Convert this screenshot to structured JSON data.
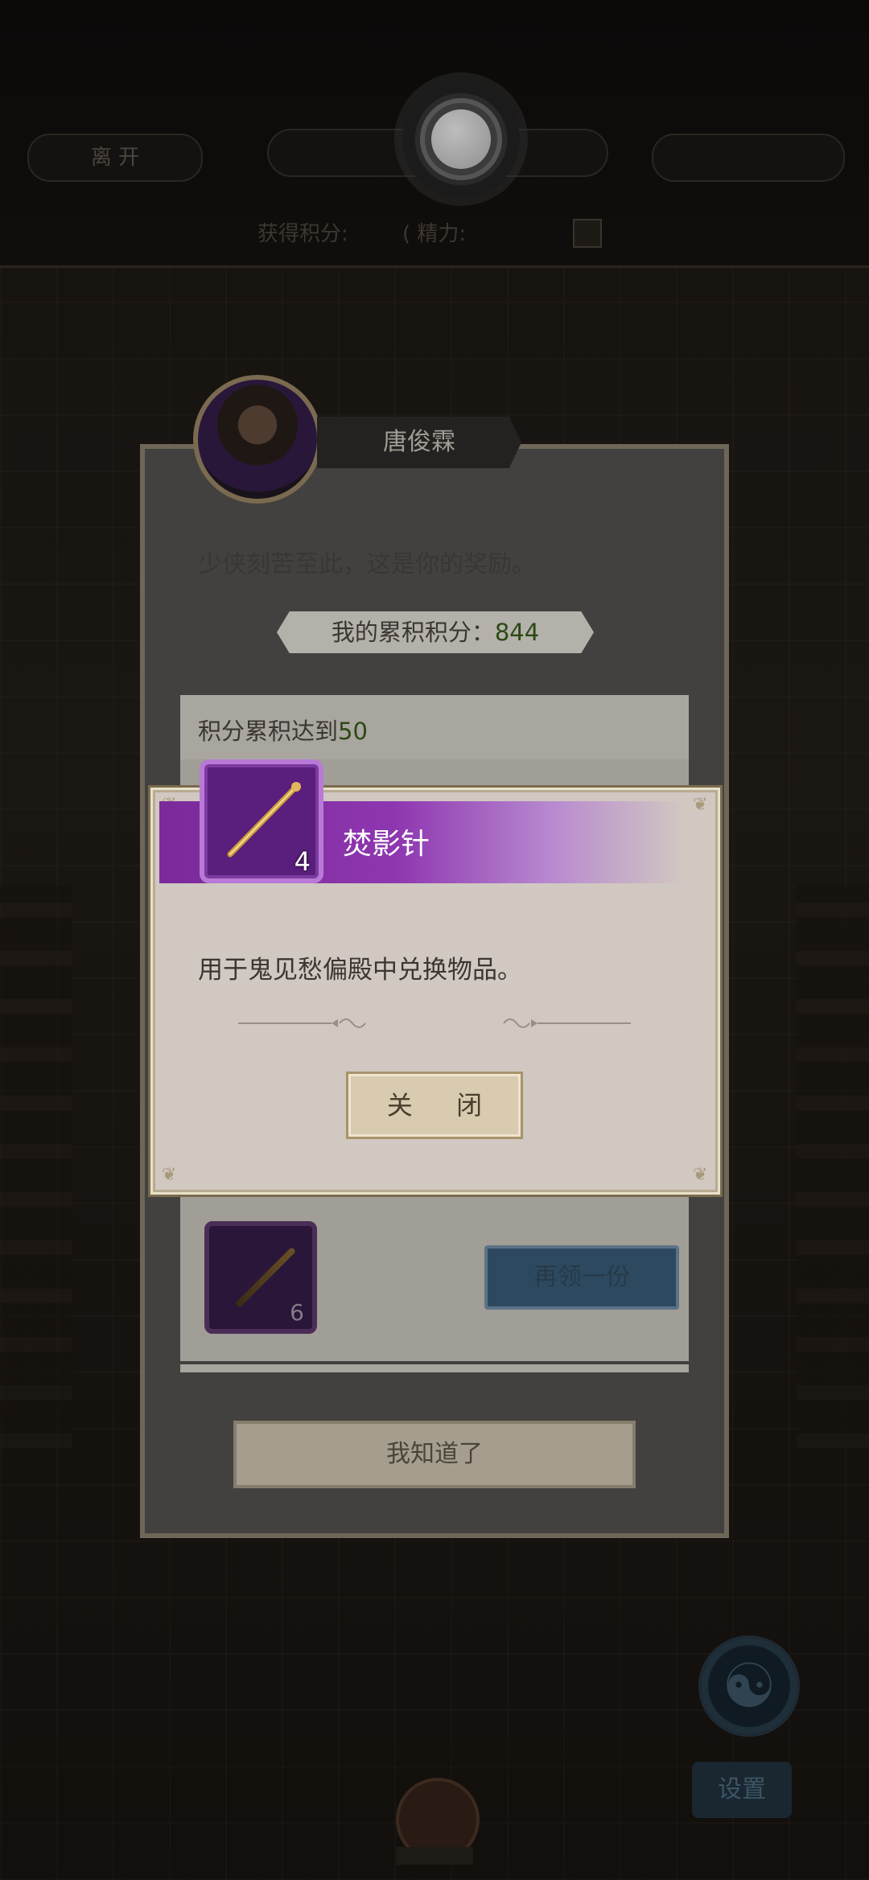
{
  "top_bar": {
    "leave_label": "离 开",
    "center_label": "",
    "right_label": "",
    "score_label": "获得积分:",
    "energy_label": "( 精力:"
  },
  "reward_panel": {
    "npc_name": "唐俊霖",
    "intro": "少侠刻苦至此，这是你的奖励。",
    "score_label": "我的累积积分：",
    "score_value": "844",
    "tier_label": "积分累积达到",
    "tier_value": "50",
    "claim_again_label": "再领一份",
    "dim_item_count": "6",
    "got_it_label": "我知道了"
  },
  "item_popup": {
    "item_name": "焚影针",
    "item_count": "4",
    "description": "用于鬼见愁偏殿中兑换物品。",
    "close_label": "关 闭",
    "rarity_color": "#8e36b0"
  },
  "hud": {
    "settings_label": "设置"
  },
  "icons": [
    "record-icon",
    "needle-icon",
    "yin-yang-icon",
    "plus-icon"
  ]
}
